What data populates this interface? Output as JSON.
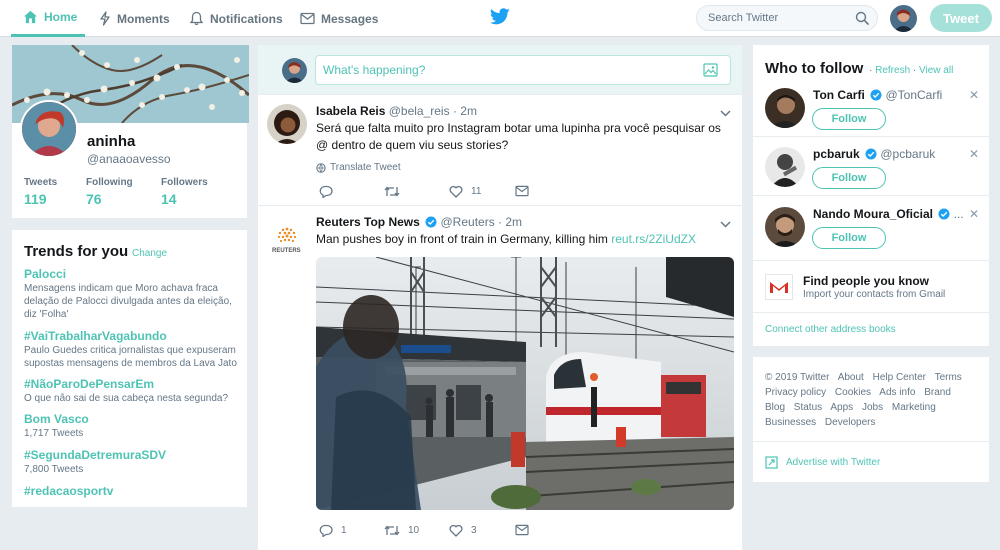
{
  "nav": {
    "home": "Home",
    "moments": "Moments",
    "notifications": "Notifications",
    "messages": "Messages"
  },
  "search": {
    "placeholder": "Search Twitter"
  },
  "tweet_button": "Tweet",
  "profile": {
    "name": "aninha",
    "handle": "@anaaoavesso",
    "stats": [
      {
        "label": "Tweets",
        "value": "119"
      },
      {
        "label": "Following",
        "value": "76"
      },
      {
        "label": "Followers",
        "value": "14"
      }
    ]
  },
  "trends": {
    "title": "Trends for you",
    "change": "Change",
    "items": [
      {
        "name": "Palocci",
        "desc": "Mensagens indicam que Moro achava fraca delação de Palocci divulgada antes da eleição, diz 'Folha'"
      },
      {
        "name": "#VaiTrabalharVagabundo",
        "desc": "Paulo Guedes critica jornalistas que expuseram supostas mensagens de membros da Lava Jato"
      },
      {
        "name": "#NãoParoDePensarEm",
        "desc": "O que não sai de sua cabeça nesta segunda?"
      },
      {
        "name": "Bom Vasco",
        "desc": "1,717 Tweets"
      },
      {
        "name": "#SegundaDetremuraSDV",
        "desc": "7,800 Tweets"
      },
      {
        "name": "#redacaosportv",
        "desc": ""
      }
    ]
  },
  "compose": {
    "placeholder": "What's happening?"
  },
  "tweets": [
    {
      "name": "Isabela Reis",
      "handle": "@bela_reis",
      "time": "· 2m",
      "text": "Será que falta muito pro Instagram botar uma lupinha pra você pesquisar os @ dentro de quem viu seus stories?",
      "translate": "Translate Tweet",
      "replies": "",
      "retweets": "",
      "likes": "11"
    },
    {
      "name": "Reuters Top News",
      "handle": "@Reuters",
      "time": "· 2m",
      "text": "Man pushes boy in front of train in Germany, killing him",
      "link": "reut.rs/2ZiUdZX",
      "avatar_label": "REUTERS",
      "replies": "1",
      "retweets": "10",
      "likes": "3"
    }
  ],
  "who_to_follow": {
    "title": "Who to follow",
    "refresh": "Refresh",
    "view_all": "View all",
    "follow_label": "Follow",
    "suggestions": [
      {
        "name": "Ton Carfi",
        "handle": "@TonCarfi"
      },
      {
        "name": "pcbaruk",
        "handle": "@pcbaruk"
      },
      {
        "name": "Nando Moura_Oficial",
        "handle": "..."
      }
    ],
    "find_title": "Find people you know",
    "find_sub": "Import your contacts from Gmail",
    "connect": "Connect other address books"
  },
  "footer": {
    "links": [
      "© 2019 Twitter",
      "About",
      "Help Center",
      "Terms",
      "Privacy policy",
      "Cookies",
      "Ads info",
      "Brand",
      "Blog",
      "Status",
      "Apps",
      "Jobs",
      "Marketing",
      "Businesses",
      "Developers"
    ],
    "advertise": "Advertise with Twitter"
  },
  "colors": {
    "accent": "#4ec3b4",
    "tweet_button": "#a6e1d9",
    "verified": "#1da1f2",
    "twitter_blue": "#1da1f2"
  }
}
